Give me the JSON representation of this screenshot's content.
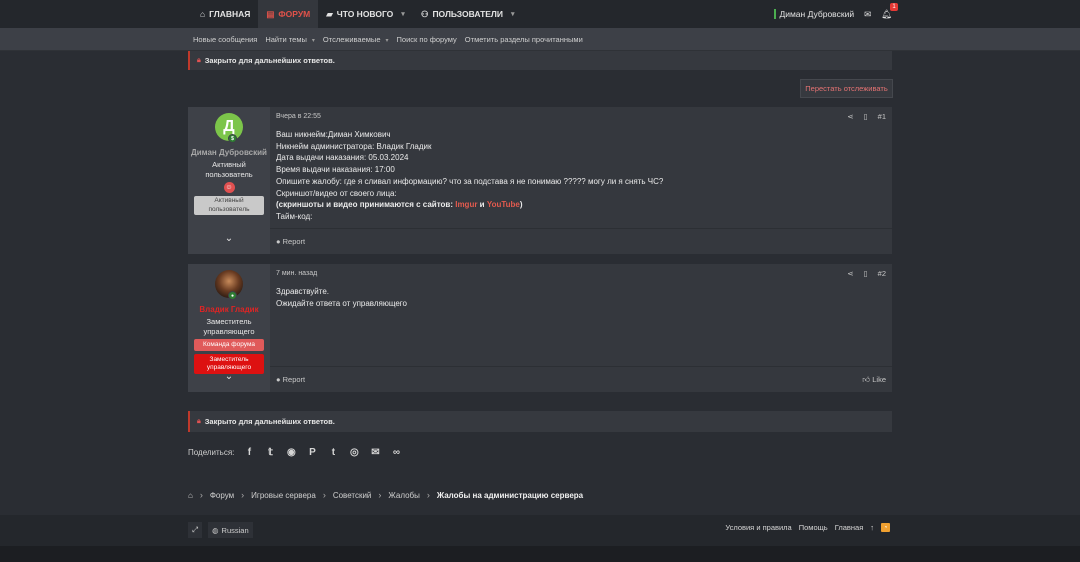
{
  "nav": {
    "home": "ГЛАВНАЯ",
    "forum": "ФОРУМ",
    "whats_new": "ЧТО НОВОГО",
    "users": "ПОЛЬЗОВАТЕЛИ"
  },
  "user": {
    "name": "Диман Дубровский",
    "alerts_count": "1"
  },
  "subnav": {
    "new_messages": "Новые сообщения",
    "find_threads": "Найти темы",
    "watched": "Отслеживаемые",
    "search_forum": "Поиск по форуму",
    "mark_read": "Отметить разделы прочитанными"
  },
  "locked_text": "Закрыто для дальнейших ответов.",
  "unwatch_label": "Перестать отслеживать",
  "posts": [
    {
      "avatar_letter": "Д",
      "username": "Диман Дубровский",
      "user_title": "Активный пользователь",
      "banner": "Активный пользователь",
      "time": "Вчера в 22:55",
      "number": "#1",
      "lines": [
        "Ваш никнейм:Диман Химкович",
        "Никнейм администратора: Владик Гладик",
        "Дата выдачи наказания: 05.03.2024",
        "Время выдачи наказания: 17:00",
        "Опишите жалобу: где я сливал информацию? что за подстава я не понимаю ????? могу ли я снять ЧС?",
        "Скриншот/видео от своего лица:"
      ],
      "screens_note_prefix": "(скриншоты и видео принимаются с сайтов: ",
      "screens_link1": "Imgur",
      "screens_and": " и ",
      "screens_link2": "YouTube",
      "screens_suffix": ")",
      "timecode": "Тайм-код:",
      "report": "Report"
    },
    {
      "username": "Владик Гладик",
      "user_title": "Заместитель управляющего",
      "banner1": "Команда форума",
      "banner2": "Заместитель управляющего",
      "time": "7 мин. назад",
      "number": "#2",
      "lines": [
        "Здравствуйте.",
        "Ожидайте ответа от управляющего"
      ],
      "report": "Report",
      "like": "Like"
    }
  ],
  "share_label": "Поделиться:",
  "share_icons": [
    "facebook-icon",
    "twitter-icon",
    "reddit-icon",
    "pinterest-icon",
    "tumblr-icon",
    "whatsapp-icon",
    "email-icon",
    "link-icon"
  ],
  "breadcrumb": {
    "forum": "Форум",
    "game_servers": "Игровые сервера",
    "sovetsky": "Советский",
    "complaints": "Жалобы",
    "current": "Жалобы на администрацию сервера"
  },
  "footer": {
    "language": "Russian",
    "terms": "Условия и правила",
    "help": "Помощь",
    "home": "Главная"
  }
}
